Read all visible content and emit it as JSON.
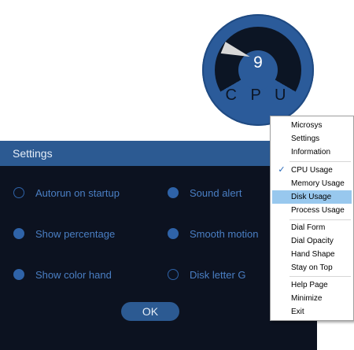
{
  "dial": {
    "value": "9",
    "label": "C P U"
  },
  "settings": {
    "title": "Settings",
    "options": [
      {
        "label": "Autorun on startup",
        "checked": false
      },
      {
        "label": "Sound alert",
        "checked": true
      },
      {
        "label": "Show percentage",
        "checked": true
      },
      {
        "label": "Smooth motion",
        "checked": true
      },
      {
        "label": "Show color hand",
        "checked": true
      },
      {
        "label": "Disk letter G",
        "checked": false
      }
    ],
    "ok_label": "OK"
  },
  "menu": {
    "items": [
      {
        "label": "Microsys"
      },
      {
        "label": "Settings"
      },
      {
        "label": "Information"
      },
      {
        "label": "CPU Usage",
        "checked": true
      },
      {
        "label": "Memory Usage"
      },
      {
        "label": "Disk Usage",
        "highlighted": true
      },
      {
        "label": "Process Usage"
      },
      {
        "label": "Dial Form"
      },
      {
        "label": "Dial Opacity"
      },
      {
        "label": "Hand Shape"
      },
      {
        "label": "Stay on Top"
      },
      {
        "label": "Help Page"
      },
      {
        "label": "Minimize"
      },
      {
        "label": "Exit"
      }
    ],
    "check_glyph": "✓"
  },
  "colors": {
    "accent": "#2c5a92",
    "window_bg": "#0c1220",
    "option_text": "#4a7fc4",
    "menu_highlight": "#98c8ee"
  }
}
